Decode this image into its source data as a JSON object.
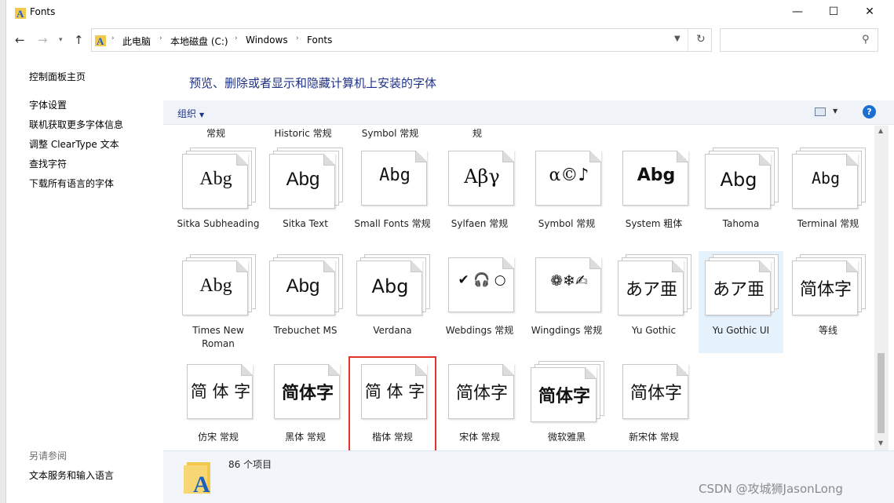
{
  "window": {
    "title": "Fonts"
  },
  "nav": {
    "back_glyph": "←",
    "forward_glyph": "→",
    "recent_glyph": "▾",
    "up_glyph": "↑",
    "breadcrumbs": [
      "此电脑",
      "本地磁盘 (C:)",
      "Windows",
      "Fonts"
    ],
    "search_placeholder": ""
  },
  "sidebar": {
    "links": [
      "控制面板主页",
      "字体设置",
      "联机获取更多字体信息",
      "调整 ClearType 文本",
      "查找字符",
      "下载所有语言的字体"
    ],
    "see_also_title": "另请参阅",
    "see_also_links": [
      "文本服务和输入语言"
    ]
  },
  "main": {
    "heading": "预览、删除或者显示和隐藏计算机上安装的字体",
    "toolbar": {
      "organize": "组织"
    },
    "top_partial_labels": [
      "常规",
      "Historic 常规",
      "Symbol 常规",
      "规"
    ],
    "fonts": [
      {
        "sample": "Abg",
        "label": "Sitka Subheading",
        "stack": true
      },
      {
        "sample": "Abg",
        "label": "Sitka Text",
        "stack": true
      },
      {
        "sample": "Abg",
        "label": "Small Fonts 常规",
        "stack": false
      },
      {
        "sample": "Αβγ",
        "label": "Sylfaen 常规",
        "stack": false
      },
      {
        "sample": "α©♪",
        "label": "Symbol 常规",
        "stack": false
      },
      {
        "sample": "Abg",
        "label": "System 粗体",
        "stack": false
      },
      {
        "sample": "Abg",
        "label": "Tahoma",
        "stack": true
      },
      {
        "sample": "Abg",
        "label": "Terminal 常规",
        "stack": true
      },
      {
        "sample": "Abg",
        "label": "Times New Roman",
        "stack": true
      },
      {
        "sample": "Abg",
        "label": "Trebuchet MS",
        "stack": true
      },
      {
        "sample": "Abg",
        "label": "Verdana",
        "stack": true
      },
      {
        "sample": "✔ 🎧 ○",
        "label": "Webdings 常规",
        "stack": false
      },
      {
        "sample": "❁❄✍",
        "label": "Wingdings 常规",
        "stack": false
      },
      {
        "sample": "あア亜",
        "label": "Yu Gothic",
        "stack": true
      },
      {
        "sample": "あア亜",
        "label": "Yu Gothic UI",
        "stack": true,
        "selected": true
      },
      {
        "sample": "简体字",
        "label": "等线",
        "stack": true
      },
      {
        "sample": "简 体 字",
        "label": "仿宋 常规",
        "stack": false
      },
      {
        "sample": "简体字",
        "label": "黑体 常规",
        "stack": false
      },
      {
        "sample": "简 体 字",
        "label": "楷体 常规",
        "stack": false,
        "highlighted": true
      },
      {
        "sample": "简体字",
        "label": "宋体 常规",
        "stack": false
      },
      {
        "sample": "简体字",
        "label": "微软雅黑",
        "stack": true
      },
      {
        "sample": "简体字",
        "label": "新宋体 常规",
        "stack": false
      }
    ]
  },
  "details": {
    "item_count": "86 个项目"
  },
  "watermark": "CSDN @攻城狮JasonLong",
  "colors": {
    "link_blue": "#1e3287",
    "accent_blue": "#1a6fd1",
    "highlight_red": "#e0342c",
    "selection": "#e5f1fb"
  }
}
